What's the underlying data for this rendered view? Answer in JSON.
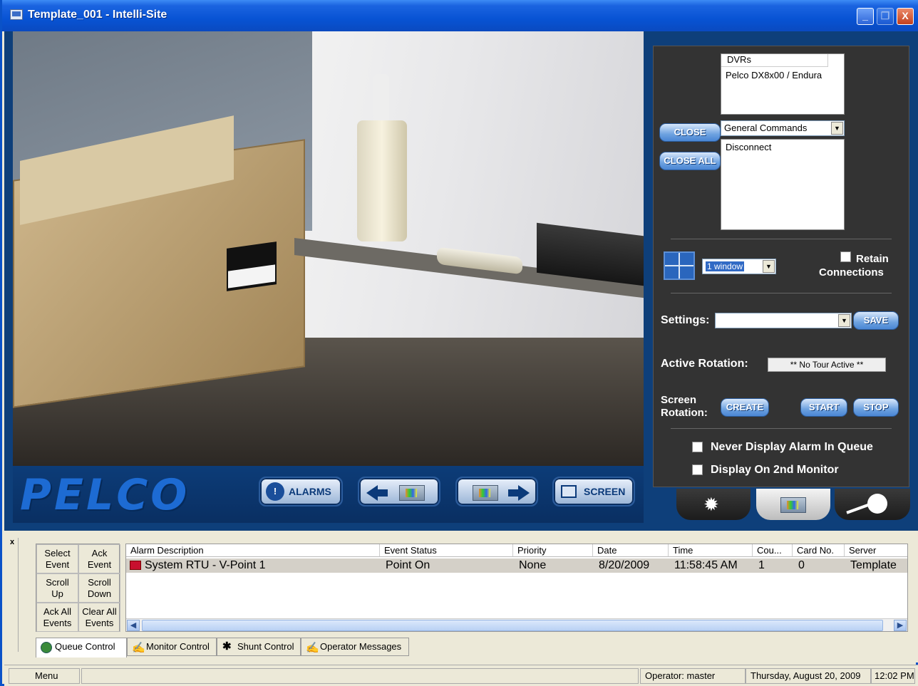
{
  "window": {
    "title": "Template_001 - Intelli-Site",
    "min_label": "_",
    "max_label": "❐",
    "close_label": "X"
  },
  "pelco_bar": {
    "logo": "PELCO",
    "alarms_label": "ALARMS",
    "screen_label": "SCREEN"
  },
  "panel": {
    "dvr_header": "DVRs",
    "dvr_item": "Pelco DX8x00 / Endura",
    "close_label": "CLOSE",
    "close_all_label": "CLOSE ALL",
    "command_select": "General Commands",
    "command_item": "Disconnect",
    "window_select": "1 window",
    "retain_label_1": "Retain",
    "retain_label_2": "Connections",
    "settings_label": "Settings:",
    "save_label": "SAVE",
    "active_rotation_label": "Active Rotation:",
    "active_rotation_value": "** No Tour Active **",
    "screen_rotation_label_1": "Screen",
    "screen_rotation_label_2": "Rotation:",
    "create_label": "CREATE",
    "start_label": "START",
    "stop_label": "STOP",
    "never_display_label": "Never Display Alarm In Queue",
    "second_monitor_label": "Display On 2nd Monitor"
  },
  "queue_buttons": {
    "select_event": [
      "Select",
      "Event"
    ],
    "ack_event": [
      "Ack",
      "Event"
    ],
    "scroll_up": [
      "Scroll",
      "Up"
    ],
    "scroll_down": [
      "Scroll",
      "Down"
    ],
    "ack_all": [
      "Ack All",
      "Events"
    ],
    "clear_all": [
      "Clear All",
      "Events"
    ]
  },
  "alarm_table": {
    "columns": [
      "Alarm Description",
      "Event Status",
      "Priority",
      "Date",
      "Time",
      "Cou...",
      "Card No.",
      "Server"
    ],
    "rows": [
      {
        "description": "System RTU - V-Point 1",
        "status": "Point On",
        "priority": "None",
        "date": "8/20/2009",
        "time": "11:58:45 AM",
        "count": "1",
        "card": "0",
        "server": "Template"
      }
    ]
  },
  "bottom_tabs": [
    "Queue Control",
    "Monitor Control",
    "Shunt Control",
    "Operator Messages"
  ],
  "statusbar": {
    "menu": "Menu",
    "operator": "Operator: master",
    "date": "Thursday, August 20, 2009",
    "time": "12:02 PM"
  },
  "side_close": "x"
}
